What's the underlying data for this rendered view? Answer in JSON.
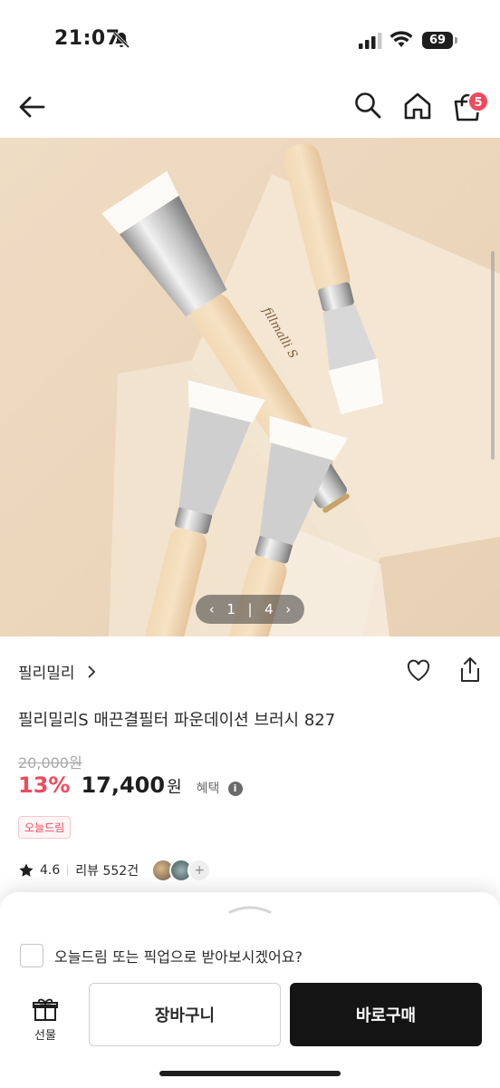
{
  "status_bar": {
    "time": "21:07",
    "battery": "69",
    "icons": [
      "bell-slash-icon",
      "signal-icon",
      "wifi-icon",
      "battery-icon"
    ]
  },
  "nav": {
    "cart_badge": "5",
    "icons": [
      "back-arrow-icon",
      "search-icon",
      "home-icon",
      "cart-icon"
    ]
  },
  "gallery": {
    "current": "1",
    "separator": "|",
    "total": "4",
    "brush_engraving": "fillmalli S"
  },
  "product": {
    "brand": "필리밀리",
    "title": "필리밀리S 매끈결필터 파운데이션 브러시 827",
    "original_price": "20,000원",
    "discount": "13%",
    "price": "17,400",
    "currency": "원",
    "benefit_label": "혜택",
    "tag": "오늘드림",
    "rating": "4.6",
    "review_label": "리뷰 552건",
    "avatar_more": "+"
  },
  "purchase_sheet": {
    "pickup_question": "오늘드림 또는 픽업으로 받아보시겠어요?",
    "pickup_checked": false,
    "gift_label": "선물",
    "cart_button": "장바구니",
    "buy_button": "바로구매"
  },
  "colors": {
    "accent": "#f04a5c",
    "buy_button": "#141414",
    "text": "#1e1e1e",
    "muted": "#a9a9a9"
  }
}
